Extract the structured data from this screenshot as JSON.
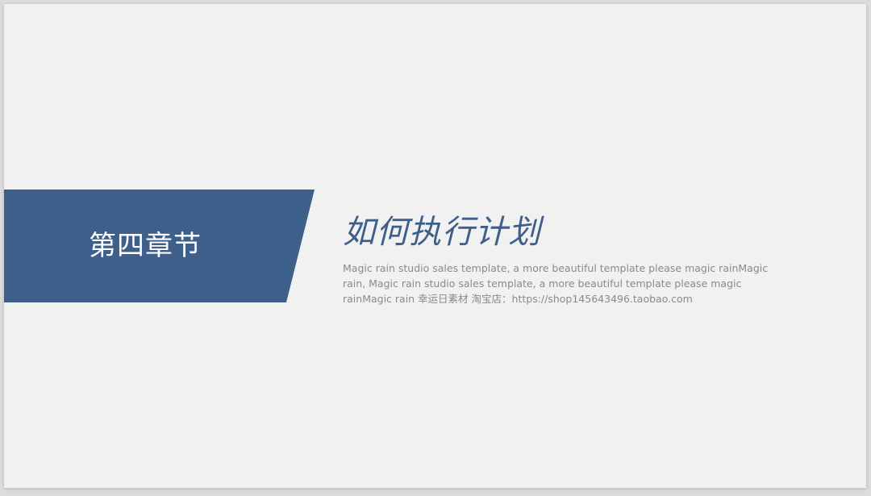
{
  "slide": {
    "chapter_label": "第四章节",
    "title": "如何执行计划",
    "description": "Magic rain studio sales template, a more beautiful template please magic rainMagic rain, Magic rain studio sales template, a more beautiful template please magic rainMagic rain 幸运日素材 淘宝店：https://shop145643496.taobao.com"
  },
  "colors": {
    "banner": "#3f5f8b",
    "title": "#3f5f8b",
    "background": "#f1f1f1",
    "description": "#8a8a8a"
  }
}
